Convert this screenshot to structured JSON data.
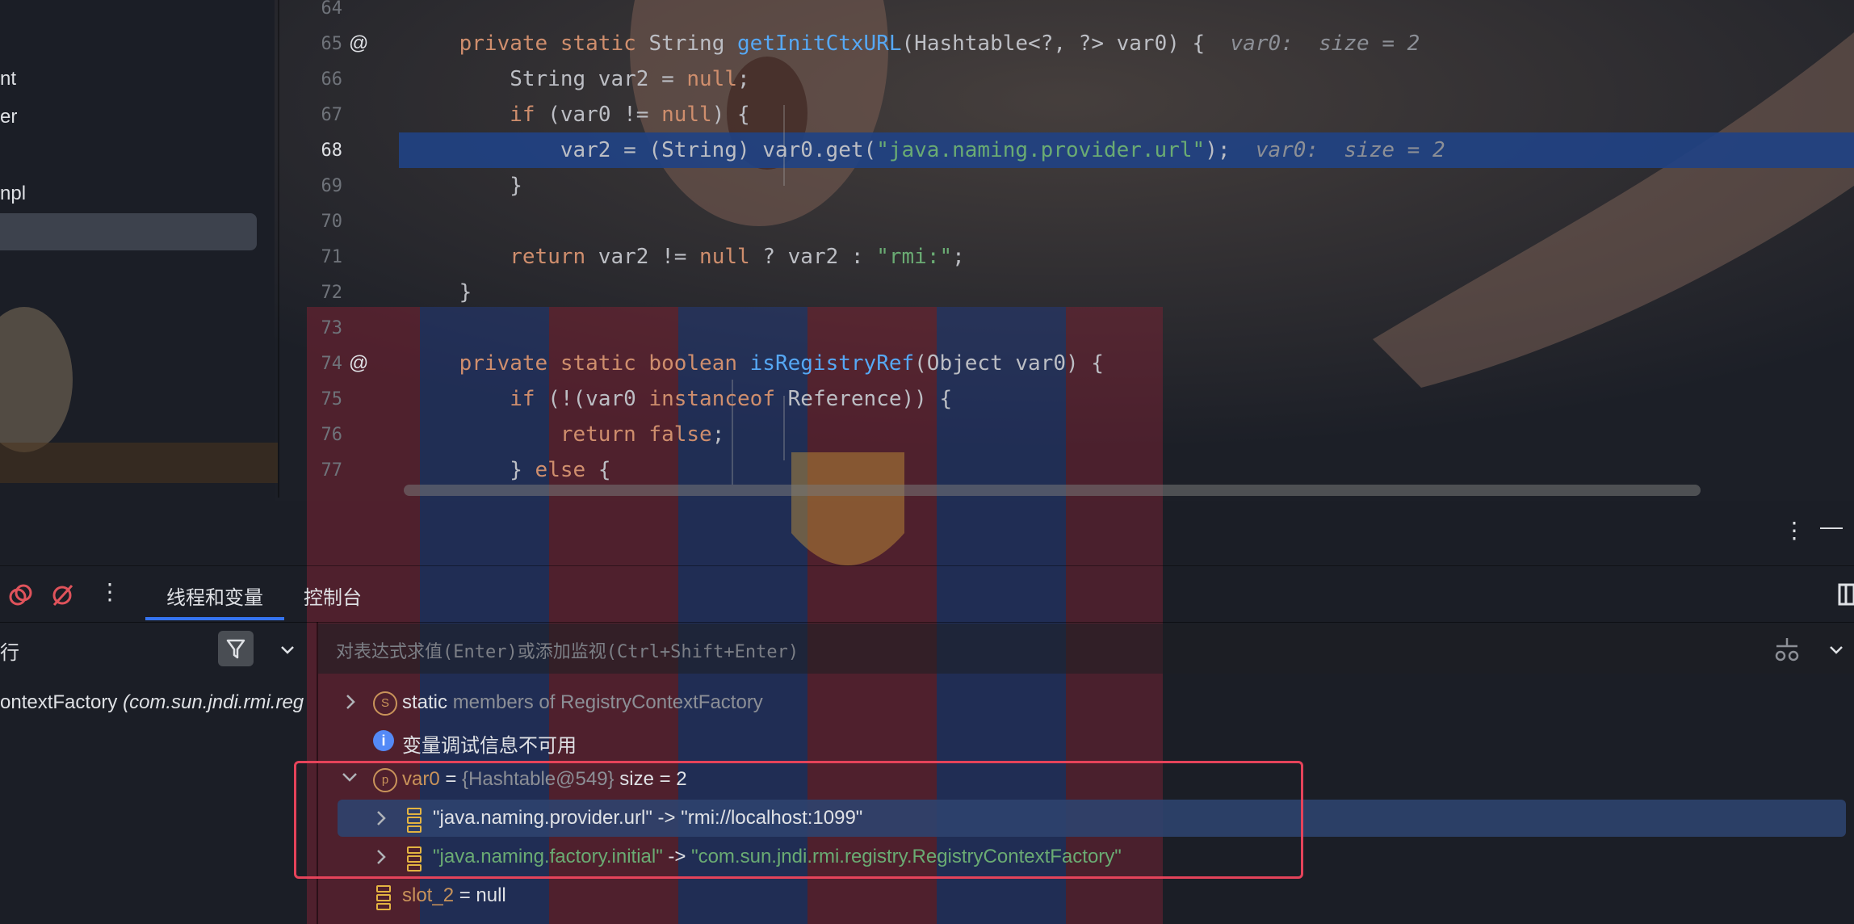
{
  "project_tree": {
    "items": [
      {
        "label": "nt"
      },
      {
        "label": "er"
      },
      {
        "label": "npl"
      }
    ]
  },
  "editor": {
    "lines": [
      {
        "num": "64",
        "segments": []
      },
      {
        "num": "65",
        "gutter": "@",
        "segments": [
          {
            "t": "    ",
            "c": "pl"
          },
          {
            "t": "private static ",
            "c": "kw"
          },
          {
            "t": "String ",
            "c": "pl"
          },
          {
            "t": "getInitCtxURL",
            "c": "fn"
          },
          {
            "t": "(Hashtable<?, ?> var0) {  ",
            "c": "pl"
          },
          {
            "t": "var0:  size = 2",
            "c": "hint"
          }
        ]
      },
      {
        "num": "66",
        "segments": [
          {
            "t": "        String var2 = ",
            "c": "pl"
          },
          {
            "t": "null",
            "c": "kw"
          },
          {
            "t": ";",
            "c": "pl"
          }
        ]
      },
      {
        "num": "67",
        "segments": [
          {
            "t": "        ",
            "c": "pl"
          },
          {
            "t": "if",
            "c": "kw"
          },
          {
            "t": " (var0 != ",
            "c": "pl"
          },
          {
            "t": "null",
            "c": "kw"
          },
          {
            "t": ") {",
            "c": "pl"
          }
        ]
      },
      {
        "num": "68",
        "current": true,
        "segments": [
          {
            "t": "            var2 = (String) var0.get(",
            "c": "pl"
          },
          {
            "t": "\"java.naming.provider.url\"",
            "c": "str"
          },
          {
            "t": ");  ",
            "c": "pl"
          },
          {
            "t": "var0:  size = 2",
            "c": "hint"
          }
        ]
      },
      {
        "num": "69",
        "segments": [
          {
            "t": "        }",
            "c": "pl"
          }
        ]
      },
      {
        "num": "70",
        "segments": []
      },
      {
        "num": "71",
        "segments": [
          {
            "t": "        ",
            "c": "pl"
          },
          {
            "t": "return",
            "c": "kw"
          },
          {
            "t": " var2 != ",
            "c": "pl"
          },
          {
            "t": "null",
            "c": "kw"
          },
          {
            "t": " ? var2 : ",
            "c": "pl"
          },
          {
            "t": "\"rmi:\"",
            "c": "str"
          },
          {
            "t": ";",
            "c": "pl"
          }
        ]
      },
      {
        "num": "72",
        "segments": [
          {
            "t": "    }",
            "c": "pl"
          }
        ]
      },
      {
        "num": "73",
        "segments": []
      },
      {
        "num": "74",
        "gutter": "@",
        "segments": [
          {
            "t": "    ",
            "c": "pl"
          },
          {
            "t": "private static boolean ",
            "c": "kw"
          },
          {
            "t": "isRegistryRef",
            "c": "fn"
          },
          {
            "t": "(Object var0) {",
            "c": "pl"
          }
        ]
      },
      {
        "num": "75",
        "segments": [
          {
            "t": "        ",
            "c": "pl"
          },
          {
            "t": "if",
            "c": "kw"
          },
          {
            "t": " (!(var0 ",
            "c": "pl"
          },
          {
            "t": "instanceof",
            "c": "kw"
          },
          {
            "t": " Reference)) {",
            "c": "pl"
          }
        ]
      },
      {
        "num": "76",
        "segments": [
          {
            "t": "            ",
            "c": "pl"
          },
          {
            "t": "return false",
            "c": "kw"
          },
          {
            "t": ";",
            "c": "pl"
          }
        ]
      },
      {
        "num": "77",
        "segments": [
          {
            "t": "        } ",
            "c": "pl"
          },
          {
            "t": "else",
            "c": "kw"
          },
          {
            "t": " {",
            "c": "pl"
          }
        ]
      }
    ]
  },
  "debug": {
    "tabs": [
      {
        "label": "线程和变量"
      },
      {
        "label": "控制台"
      }
    ],
    "frames_header": "行",
    "frame_item": {
      "name": "ontextFactory",
      "location": "(com.sun.jndi.rmi.reg"
    },
    "eval_placeholder": "对表达式求值(Enter)或添加监视(Ctrl+Shift+Enter)",
    "variables": {
      "static_row": {
        "badge": "S",
        "name": "static",
        "desc": "members of RegistryContextFactory"
      },
      "info_row": {
        "text": "变量调试信息不可用"
      },
      "var0_row": {
        "badge": "p",
        "name": "var0",
        "eq": " = ",
        "ref": "{Hashtable@549}",
        "extra": "  size = 2"
      },
      "entries": [
        {
          "key": "\"java.naming.provider.url\"",
          "arrow": " -> ",
          "value": "\"rmi://localhost:1099\"",
          "key_color": "#dfe1e5"
        },
        {
          "key": "\"java.naming.factory.initial\"",
          "arrow": " -> ",
          "value": "\"com.sun.jndi.rmi.registry.RegistryContextFactory\"",
          "key_color": "#6aab73"
        }
      ],
      "slot_row": {
        "name": "slot_2",
        "eq": " = ",
        "value": "null"
      }
    }
  },
  "icons": [
    "rerun-icon",
    "mute-breakpoints-icon",
    "more-vertical-icon",
    "filter-icon",
    "chevron-down-icon",
    "layout-icon",
    "minimize-icon",
    "add-watch-icon",
    "info-icon"
  ],
  "colors": {
    "accent": "#3574f0",
    "highlight_box": "#e5435a",
    "keyword": "#cf8e6d",
    "function": "#56a8f5",
    "string": "#6aab73",
    "current_line": "#214283"
  }
}
